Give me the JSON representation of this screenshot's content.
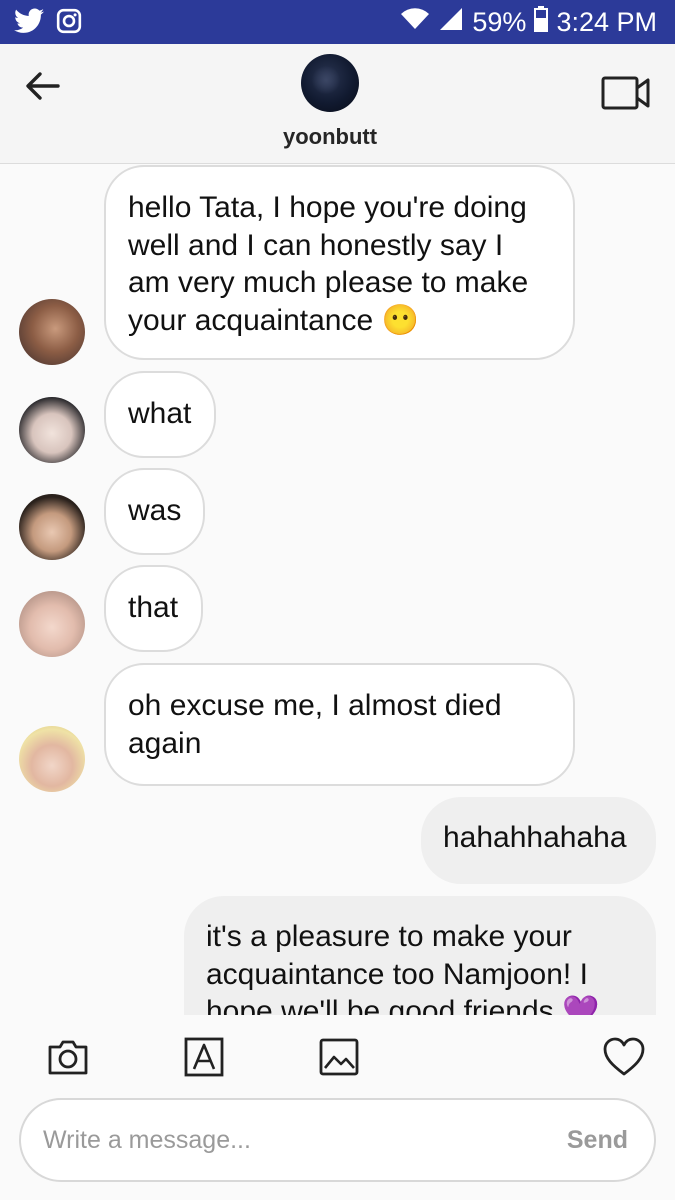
{
  "status_bar": {
    "battery": "59%",
    "time": "3:24 PM",
    "icons": [
      "twitter-icon",
      "instagram-icon",
      "wifi-icon",
      "signal-icon",
      "battery-icon"
    ],
    "background_color": "#2c3a99"
  },
  "header": {
    "username": "yoonbutt",
    "icons": [
      "back-arrow-icon",
      "video-call-icon"
    ]
  },
  "messages": [
    {
      "direction": "in",
      "text": "hello Tata, I hope you're doing well and I can honestly say I am very much please to make your acquaintance 😶"
    },
    {
      "direction": "in",
      "text": "what"
    },
    {
      "direction": "in",
      "text": "was"
    },
    {
      "direction": "in",
      "text": "that"
    },
    {
      "direction": "in",
      "text": "oh excuse me, I almost died again"
    },
    {
      "direction": "out",
      "text": "hahahhahaha"
    },
    {
      "direction": "out",
      "text": "it's a pleasure to make your acquaintance too Namjoon! I hope we'll be good friends 💜"
    }
  ],
  "toolbar": {
    "icons": [
      "camera-icon",
      "text-style-icon",
      "gallery-icon",
      "heart-icon"
    ]
  },
  "composer": {
    "placeholder": "Write a message...",
    "send_label": "Send"
  }
}
